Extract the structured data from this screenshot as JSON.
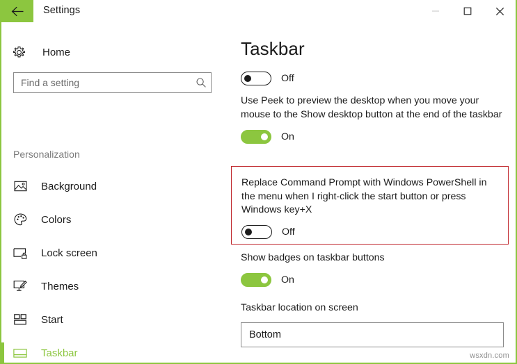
{
  "window": {
    "title": "Settings",
    "back_icon": "back-arrow-icon",
    "accent_color": "#8cc63f",
    "minimize_label": "—",
    "maximize_label": "☐",
    "close_label": "✕"
  },
  "sidebar": {
    "home": {
      "label": "Home",
      "icon": "gear-icon"
    },
    "search": {
      "value": "",
      "placeholder": "Find a setting",
      "icon": "search-icon"
    },
    "section_label": "Personalization",
    "items": [
      {
        "label": "Background",
        "icon": "image-icon",
        "selected": false
      },
      {
        "label": "Colors",
        "icon": "palette-icon",
        "selected": false
      },
      {
        "label": "Lock screen",
        "icon": "lock-screen-icon",
        "selected": false
      },
      {
        "label": "Themes",
        "icon": "themes-brush-icon",
        "selected": false
      },
      {
        "label": "Start",
        "icon": "start-tiles-icon",
        "selected": false
      },
      {
        "label": "Taskbar",
        "icon": "taskbar-icon",
        "selected": true
      }
    ]
  },
  "main": {
    "page_title": "Taskbar",
    "top_toggle": {
      "state": "Off",
      "on": false
    },
    "peek": {
      "description": "Use Peek to preview the desktop when you move your mouse to the Show desktop button at the end of the taskbar",
      "state": "On",
      "on": true
    },
    "powershell": {
      "description": "Replace Command Prompt with Windows PowerShell in the menu when I right-click the start button or press Windows key+X",
      "state": "Off",
      "on": false,
      "highlight_color": "#c0272d"
    },
    "badges": {
      "description": "Show badges on taskbar buttons",
      "state": "On",
      "on": true
    },
    "location": {
      "description": "Taskbar location on screen",
      "value": "Bottom"
    }
  },
  "watermark": "wsxdn.com"
}
